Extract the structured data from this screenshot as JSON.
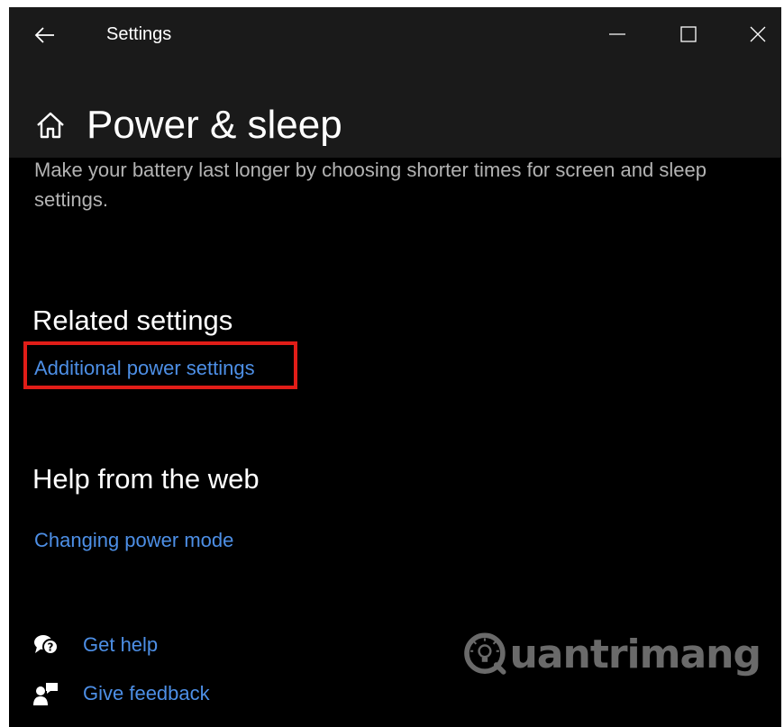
{
  "titlebar": {
    "app_title": "Settings",
    "back_icon": "arrow-left-icon",
    "controls": [
      "minimize-icon",
      "maximize-icon",
      "close-icon"
    ]
  },
  "page": {
    "title": "Power & sleep",
    "home_icon": "home-icon",
    "description": "Make your battery last longer by choosing shorter times for screen and sleep settings."
  },
  "related_settings": {
    "heading": "Related settings",
    "link": "Additional power settings"
  },
  "help_web": {
    "heading": "Help from the web",
    "link": "Changing power mode"
  },
  "help_links": [
    {
      "label": "Get help",
      "icon": "chat-help-icon"
    },
    {
      "label": "Give feedback",
      "icon": "feedback-icon"
    }
  ],
  "colors": {
    "background": "#000000",
    "header_background": "#1a1a1a",
    "link": "#4d8fe6",
    "highlight": "#e11d18"
  },
  "watermark": {
    "text": "uantrimang"
  }
}
